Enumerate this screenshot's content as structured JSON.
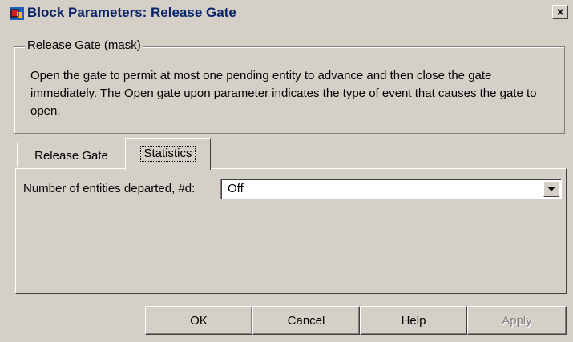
{
  "window": {
    "title": "Block Parameters: Release Gate",
    "close_symbol": "×",
    "app_icon": "simulink-block-icon",
    "title_color": "#0a246a"
  },
  "group": {
    "legend": "Release Gate (mask)",
    "description": "Open the gate to permit at most one pending entity to advance and then close the gate immediately. The Open gate upon parameter indicates the type of event that causes the gate to open."
  },
  "tabs": [
    {
      "label": "Release Gate",
      "active": false
    },
    {
      "label": "Statistics",
      "active": true
    }
  ],
  "statistics": {
    "departed_label": "Number of entities departed, #d:",
    "departed_value": "Off"
  },
  "buttons": {
    "ok": "OK",
    "cancel": "Cancel",
    "help": "Help",
    "apply": "Apply"
  }
}
